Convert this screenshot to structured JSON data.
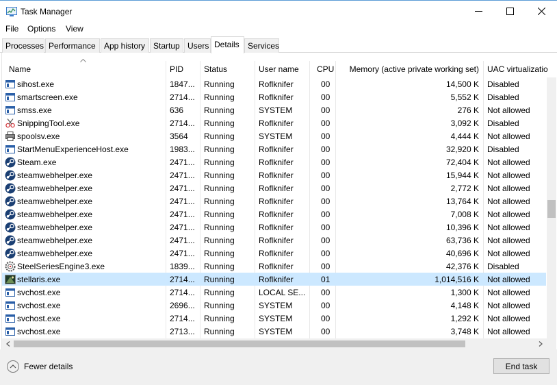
{
  "window": {
    "title": "Task Manager"
  },
  "menu": [
    "File",
    "Options",
    "View"
  ],
  "tabs": [
    "Processes",
    "Performance",
    "App history",
    "Startup",
    "Users",
    "Details",
    "Services"
  ],
  "active_tab": "Details",
  "columns": [
    "Name",
    "PID",
    "Status",
    "User name",
    "CPU",
    "Memory (active private working set)",
    "UAC virtualizatio"
  ],
  "sort_column": "Name",
  "selected_row": "stellaris.exe",
  "rows": [
    {
      "name": "sihost.exe",
      "pid": "1847...",
      "status": "Running",
      "user": "Roflknifer",
      "cpu": "00",
      "mem": "14,500 K",
      "uac": "Disabled",
      "icon": "window-icon"
    },
    {
      "name": "smartscreen.exe",
      "pid": "2714...",
      "status": "Running",
      "user": "Roflknifer",
      "cpu": "00",
      "mem": "5,552 K",
      "uac": "Disabled",
      "icon": "window-icon"
    },
    {
      "name": "smss.exe",
      "pid": "636",
      "status": "Running",
      "user": "SYSTEM",
      "cpu": "00",
      "mem": "276 K",
      "uac": "Not allowed",
      "icon": "window-icon"
    },
    {
      "name": "SnippingTool.exe",
      "pid": "2714...",
      "status": "Running",
      "user": "Roflknifer",
      "cpu": "00",
      "mem": "3,092 K",
      "uac": "Disabled",
      "icon": "scissors-icon"
    },
    {
      "name": "spoolsv.exe",
      "pid": "3564",
      "status": "Running",
      "user": "SYSTEM",
      "cpu": "00",
      "mem": "4,444 K",
      "uac": "Not allowed",
      "icon": "printer-icon"
    },
    {
      "name": "StartMenuExperienceHost.exe",
      "pid": "1983...",
      "status": "Running",
      "user": "Roflknifer",
      "cpu": "00",
      "mem": "32,920 K",
      "uac": "Disabled",
      "icon": "window-icon"
    },
    {
      "name": "Steam.exe",
      "pid": "2471...",
      "status": "Running",
      "user": "Roflknifer",
      "cpu": "00",
      "mem": "72,404 K",
      "uac": "Not allowed",
      "icon": "steam-icon"
    },
    {
      "name": "steamwebhelper.exe",
      "pid": "2471...",
      "status": "Running",
      "user": "Roflknifer",
      "cpu": "00",
      "mem": "15,944 K",
      "uac": "Not allowed",
      "icon": "steam-icon"
    },
    {
      "name": "steamwebhelper.exe",
      "pid": "2471...",
      "status": "Running",
      "user": "Roflknifer",
      "cpu": "00",
      "mem": "2,772 K",
      "uac": "Not allowed",
      "icon": "steam-icon"
    },
    {
      "name": "steamwebhelper.exe",
      "pid": "2471...",
      "status": "Running",
      "user": "Roflknifer",
      "cpu": "00",
      "mem": "13,764 K",
      "uac": "Not allowed",
      "icon": "steam-icon"
    },
    {
      "name": "steamwebhelper.exe",
      "pid": "2471...",
      "status": "Running",
      "user": "Roflknifer",
      "cpu": "00",
      "mem": "7,008 K",
      "uac": "Not allowed",
      "icon": "steam-icon"
    },
    {
      "name": "steamwebhelper.exe",
      "pid": "2471...",
      "status": "Running",
      "user": "Roflknifer",
      "cpu": "00",
      "mem": "10,396 K",
      "uac": "Not allowed",
      "icon": "steam-icon"
    },
    {
      "name": "steamwebhelper.exe",
      "pid": "2471...",
      "status": "Running",
      "user": "Roflknifer",
      "cpu": "00",
      "mem": "63,736 K",
      "uac": "Not allowed",
      "icon": "steam-icon"
    },
    {
      "name": "steamwebhelper.exe",
      "pid": "2471...",
      "status": "Running",
      "user": "Roflknifer",
      "cpu": "00",
      "mem": "40,696 K",
      "uac": "Not allowed",
      "icon": "steam-icon"
    },
    {
      "name": "SteelSeriesEngine3.exe",
      "pid": "1839...",
      "status": "Running",
      "user": "Roflknifer",
      "cpu": "00",
      "mem": "42,376 K",
      "uac": "Disabled",
      "icon": "gear-icon"
    },
    {
      "name": "stellaris.exe",
      "pid": "2714...",
      "status": "Running",
      "user": "Roflknifer",
      "cpu": "01",
      "mem": "1,014,516 K",
      "uac": "Not allowed",
      "icon": "game-icon"
    },
    {
      "name": "svchost.exe",
      "pid": "2714...",
      "status": "Running",
      "user": "LOCAL SE...",
      "cpu": "00",
      "mem": "1,300 K",
      "uac": "Not allowed",
      "icon": "window-icon"
    },
    {
      "name": "svchost.exe",
      "pid": "2696...",
      "status": "Running",
      "user": "SYSTEM",
      "cpu": "00",
      "mem": "4,148 K",
      "uac": "Not allowed",
      "icon": "window-icon"
    },
    {
      "name": "svchost.exe",
      "pid": "2714...",
      "status": "Running",
      "user": "SYSTEM",
      "cpu": "00",
      "mem": "1,292 K",
      "uac": "Not allowed",
      "icon": "window-icon"
    },
    {
      "name": "svchost.exe",
      "pid": "2713...",
      "status": "Running",
      "user": "SYSTEM",
      "cpu": "00",
      "mem": "3,748 K",
      "uac": "Not allowed",
      "icon": "window-icon"
    }
  ],
  "footer": {
    "fewer_details": "Fewer details",
    "end_task": "End task"
  },
  "colors": {
    "selection": "#cce8ff",
    "footer_bg": "#f0f0f0",
    "steam": "#1b3f73"
  }
}
